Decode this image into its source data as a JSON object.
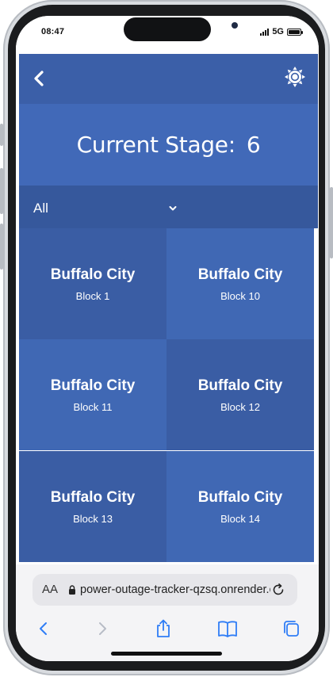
{
  "status": {
    "time": "08:47",
    "network": "5G"
  },
  "appbar": {
    "back_icon": "chevron-left-icon",
    "theme_icon": "sun-icon"
  },
  "stage": {
    "label": "Current Stage:",
    "value": "6"
  },
  "filter": {
    "selected": "All"
  },
  "blocks": [
    {
      "city": "Buffalo City",
      "block": "Block 1"
    },
    {
      "city": "Buffalo City",
      "block": "Block 10"
    },
    {
      "city": "Buffalo City",
      "block": "Block 11"
    },
    {
      "city": "Buffalo City",
      "block": "Block 12"
    },
    {
      "city": "Buffalo City",
      "block": "Block 13"
    },
    {
      "city": "Buffalo City",
      "block": "Block 14"
    }
  ],
  "browser": {
    "text_size": "AA",
    "url": "power-outage-tracker-qzsq.onrender.com"
  },
  "colors": {
    "appbar": "#3b5fa8",
    "stage": "#4169b8",
    "tile_dark": "#3a5da4",
    "tile_light": "#4068b4",
    "ios_blue": "#2f7df6"
  }
}
